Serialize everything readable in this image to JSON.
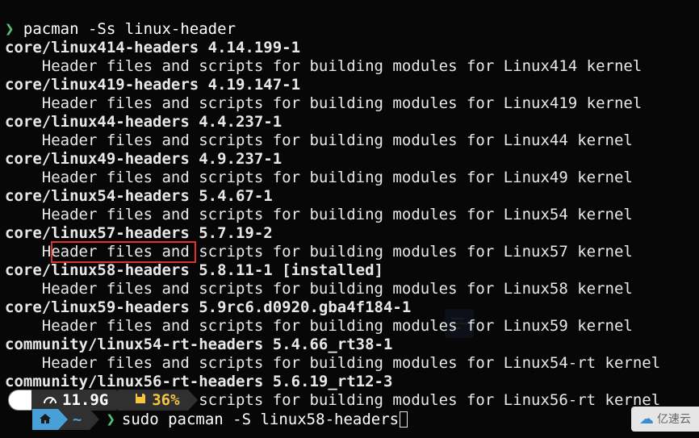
{
  "prompt1": {
    "arrow": "❯",
    "command": "pacman -Ss linux-header"
  },
  "packages": [
    {
      "name": "core/linux414-headers 4.14.199-1",
      "desc": "    Header files and scripts for building modules for Linux414 kernel"
    },
    {
      "name": "core/linux419-headers 4.19.147-1",
      "desc": "    Header files and scripts for building modules for Linux419 kernel"
    },
    {
      "name": "core/linux44-headers 4.4.237-1",
      "desc": "    Header files and scripts for building modules for Linux44 kernel"
    },
    {
      "name": "core/linux49-headers 4.9.237-1",
      "desc": "    Header files and scripts for building modules for Linux49 kernel"
    },
    {
      "name": "core/linux54-headers 5.4.67-1",
      "desc": "    Header files and scripts for building modules for Linux54 kernel"
    },
    {
      "name": "core/linux57-headers 5.7.19-2",
      "desc": "    Header files and scripts for building modules for Linux57 kernel"
    },
    {
      "name": "core/linux58-headers 5.8.11-1 [installed]",
      "desc": "    Header files and scripts for building modules for Linux58 kernel"
    },
    {
      "name": "core/linux59-headers 5.9rc6.d0920.gba4f184-1",
      "desc": "    Header files and scripts for building modules for Linux59 kernel"
    },
    {
      "name": "community/linux54-rt-headers 5.4.66_rt38-1",
      "desc": "    Header files and scripts for building modules for Linux54-rt kernel"
    },
    {
      "name": "community/linux56-rt-headers 5.6.19_rt12-3",
      "desc": "    Header files and scripts for building modules for Linux56-rt kernel"
    }
  ],
  "status": {
    "disk": "11.9G",
    "memory": "36%"
  },
  "prompt2": {
    "home_icon": "🏠",
    "dir": "~",
    "arrow": "❯",
    "command": "sudo pacman -S linux58-headers"
  },
  "watermark": {
    "brand": "亿速云"
  }
}
